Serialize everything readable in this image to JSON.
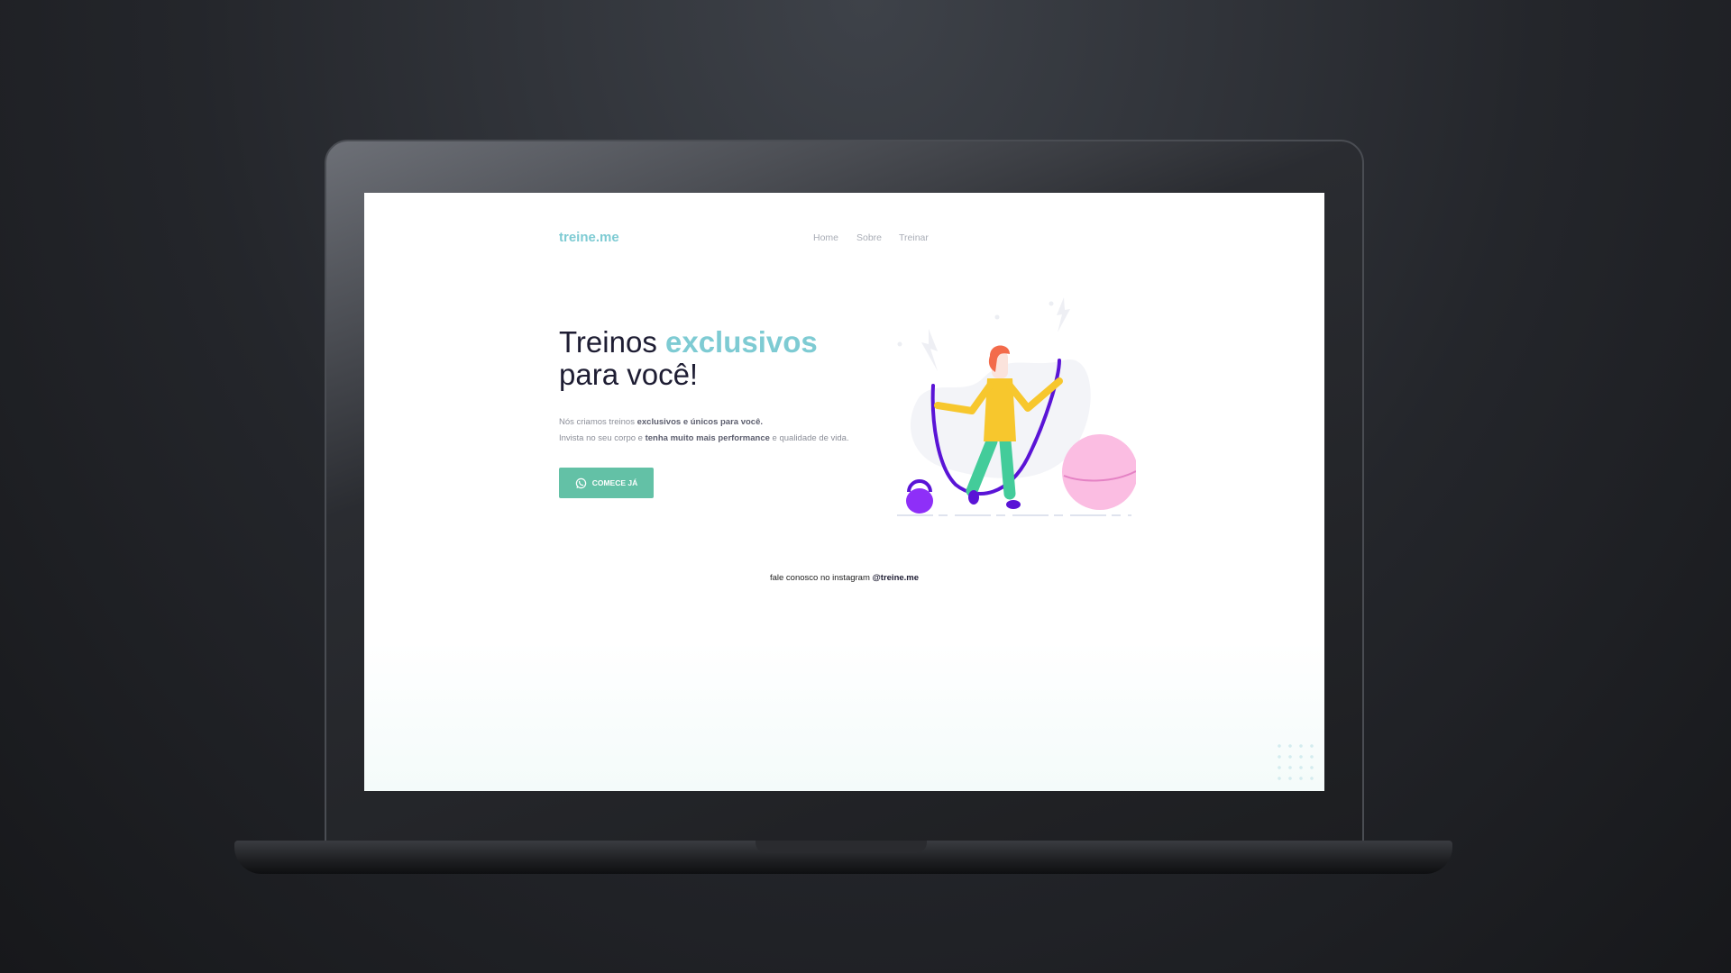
{
  "site": {
    "logo": "treine.me"
  },
  "nav": [
    {
      "label": "Home"
    },
    {
      "label": "Sobre"
    },
    {
      "label": "Treinar"
    }
  ],
  "hero": {
    "title_a": "Treinos ",
    "title_highlight": "exclusivos",
    "title_b": "para você!",
    "p1_a": "Nós criamos treinos ",
    "p1_b": "exclusivos e únicos para você.",
    "p2_a": "Invista no seu corpo e ",
    "p2_b": "tenha muito mais performance",
    "p2_c": " e qualidade de vida.",
    "cta": "COMECE JÁ",
    "cta_icon": "whatsapp-icon"
  },
  "footer": {
    "text": "fale conosco no instagram ",
    "handle": "@treine.me"
  },
  "colors": {
    "accent": "#7ecbd3",
    "button": "#63c1a6",
    "rope": "#5a14d6"
  }
}
